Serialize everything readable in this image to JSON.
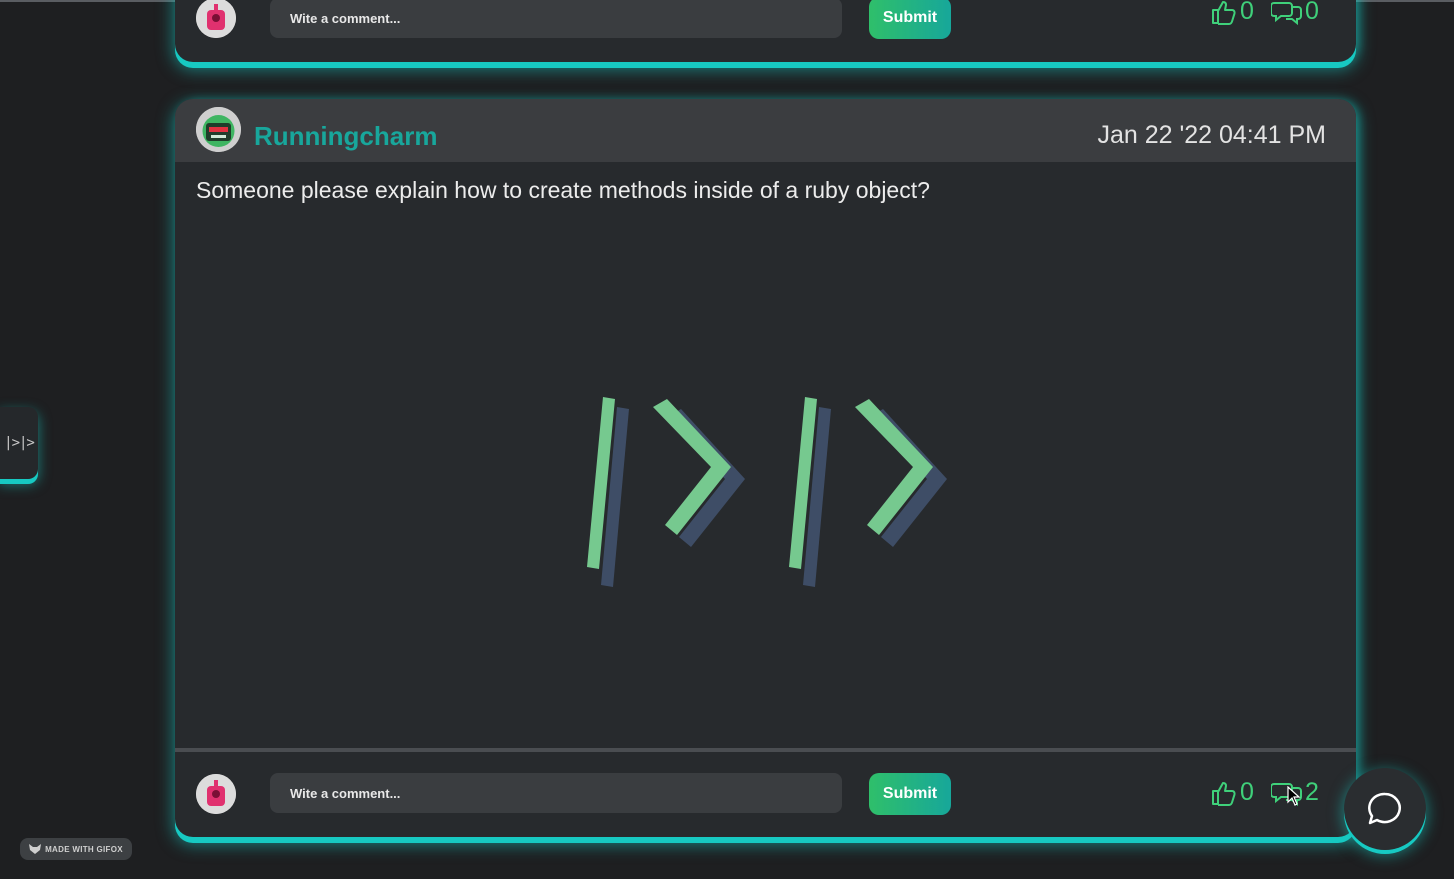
{
  "top_post": {
    "comment_placeholder": "Wite a comment...",
    "submit_label": "Submit",
    "likes": "0",
    "comments": "0"
  },
  "post": {
    "author": "Runningcharm",
    "date": "Jan 22 '22 04:41 PM",
    "body": "Someone please explain how to create methods inside of a ruby object?",
    "image_icon": "logo-slash-chevron-icon",
    "comment_placeholder": "Wite a comment...",
    "submit_label": "Submit",
    "likes": "0",
    "comments": "2"
  },
  "side_tab": {
    "label": "|>|>"
  },
  "chat_button": {
    "icon": "chat-bubble-icon"
  },
  "watermark": {
    "label": "MADE WITH GIFOX"
  },
  "colors": {
    "accent": "#17c9c2",
    "author": "#18a79c",
    "stat_green": "#3fd07a",
    "card_bg": "#272a2d",
    "header_bg": "#3b3d40",
    "page_bg": "#1e1f21"
  }
}
